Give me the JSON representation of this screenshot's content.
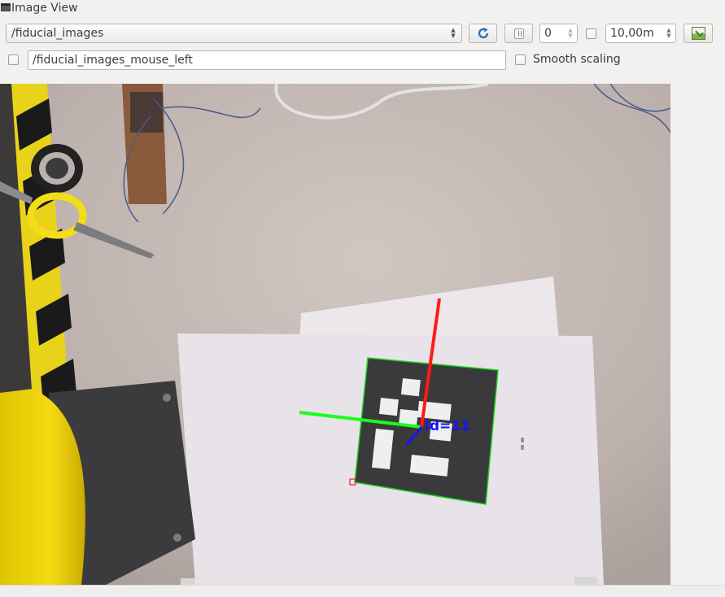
{
  "window": {
    "title": "Image View"
  },
  "toolbar": {
    "topic": "/fiducial_images",
    "rate_value": "0",
    "timeout_value": "10,00m",
    "refresh_icon": "refresh-icon",
    "pause_icon": "pause-icon",
    "save_icon": "save-image-icon"
  },
  "mouse": {
    "topic": "/fiducial_images_mouse_left",
    "enabled": false
  },
  "options": {
    "smooth_label": "Smooth scaling",
    "smooth_enabled": false,
    "rate_enabled": false
  },
  "image": {
    "overlay_label": "id=11",
    "axis_colors": {
      "x": "#ff1a1a",
      "y": "#1aff1a",
      "z": "#1414ff"
    },
    "marker_outline_color": "#18d818"
  }
}
